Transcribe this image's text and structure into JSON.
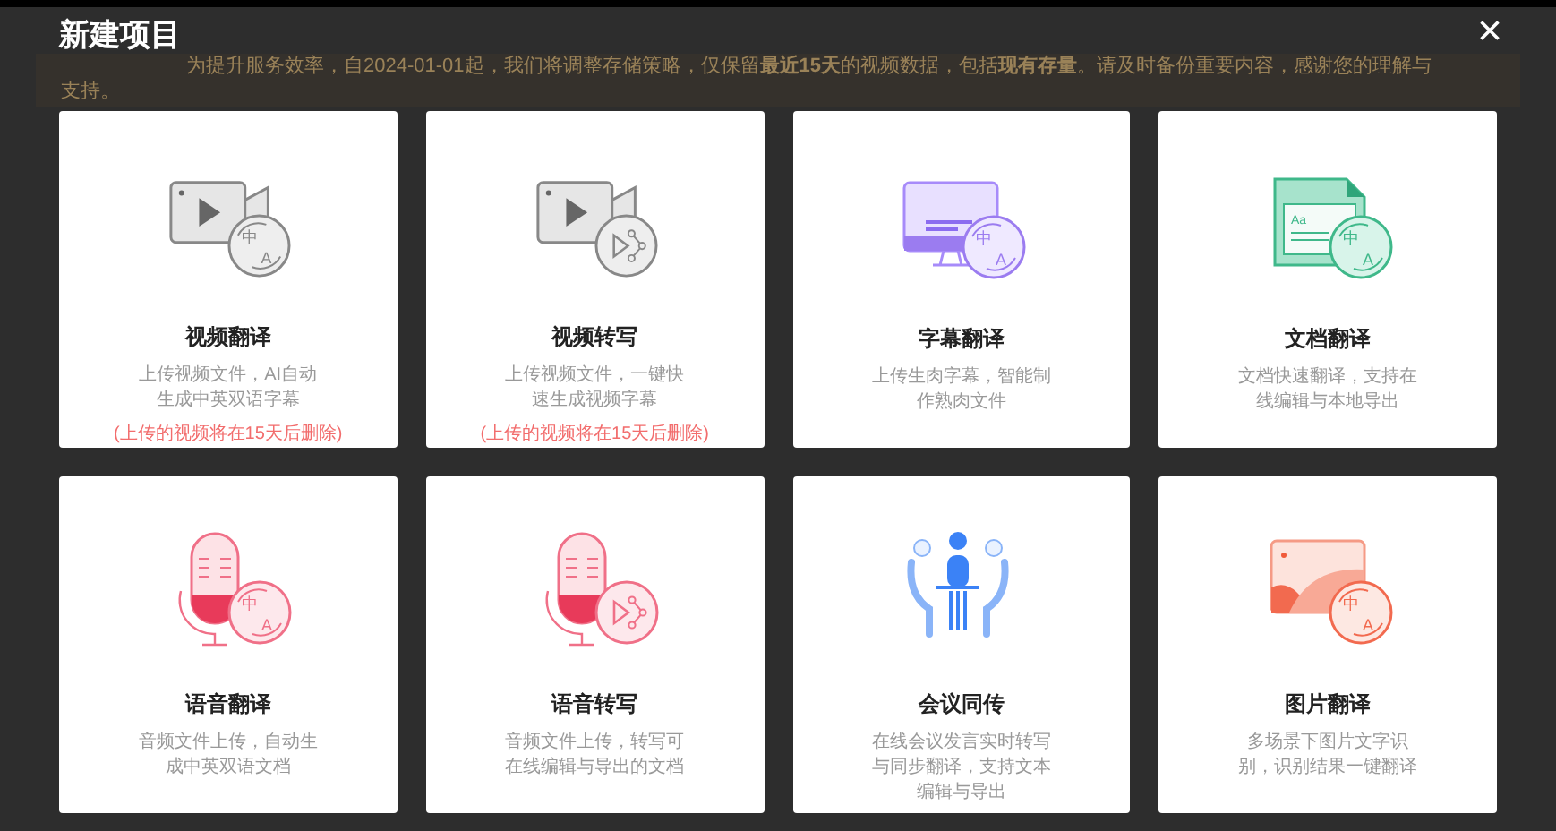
{
  "dialog": {
    "title": "新建项目",
    "close": "×"
  },
  "notice": {
    "line_1": "为提升服务效率，自2024-01-01起，我们将调整存储策略，仅保留**最近15天**的视频数据，包括**现有存量**。请及时备份重要内容，感谢您的理解与",
    "line_2": "支持。"
  },
  "cards": [
    {
      "kind": "video-translate",
      "badge": [
        "中",
        "A"
      ],
      "title": "视频翻译",
      "description": "上传视频文件，AI自动生成中英双语字幕",
      "warning": "(上传的视频将在15天后删除)"
    },
    {
      "kind": "video-transcribe",
      "title": "视频转写",
      "description": "上传视频文件，一键快速生成视频字幕",
      "warning": "(上传的视频将在15天后删除)"
    },
    {
      "kind": "subtitle",
      "badge": [
        "中",
        "A"
      ],
      "title": "字幕翻译",
      "description": "上传生肉字幕，智能制作熟肉文件"
    },
    {
      "kind": "document",
      "icon_text": "Aa",
      "badge": [
        "中",
        "A"
      ],
      "title": "文档翻译",
      "description": "文档快速翻译，支持在线编辑与本地导出"
    },
    {
      "kind": "audio-translate",
      "badge": [
        "中",
        "A"
      ],
      "title": "语音翻译",
      "description": "音频文件上传，自动生成中英双语文档"
    },
    {
      "kind": "audio-transcribe",
      "title": "语音转写",
      "description": "音频文件上传，转写可在线编辑与导出的文档"
    },
    {
      "kind": "meeting",
      "title": "会议同传",
      "description": "在线会议发言实时转写与同步翻译，支持文本编辑与导出"
    },
    {
      "kind": "image",
      "badge": [
        "中",
        "A"
      ],
      "title": "图片翻译",
      "description": "多场景下图片文字识别，识别结果一键翻译"
    }
  ]
}
